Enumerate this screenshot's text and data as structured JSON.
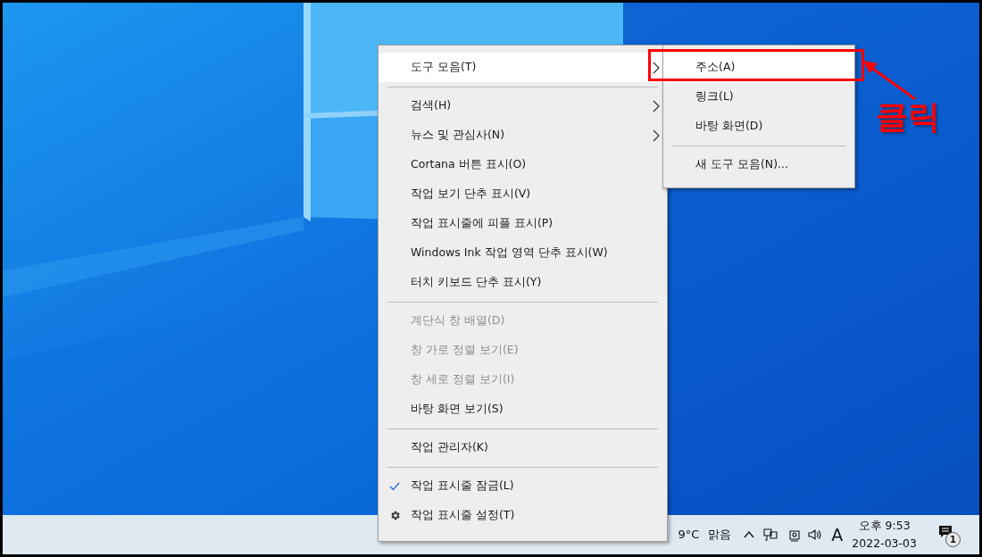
{
  "context_menu": {
    "items": [
      {
        "kind": "item",
        "label": "도구 모음(T)",
        "submenu": true,
        "selected": true,
        "disabled": false
      },
      {
        "kind": "separator"
      },
      {
        "kind": "item",
        "label": "검색(H)",
        "submenu": true,
        "selected": false,
        "disabled": false
      },
      {
        "kind": "item",
        "label": "뉴스 및 관심사(N)",
        "submenu": true,
        "selected": false,
        "disabled": false
      },
      {
        "kind": "item",
        "label": "Cortana 버튼 표시(O)",
        "submenu": false,
        "selected": false,
        "disabled": false
      },
      {
        "kind": "item",
        "label": "작업 보기 단추 표시(V)",
        "submenu": false,
        "selected": false,
        "disabled": false
      },
      {
        "kind": "item",
        "label": "작업 표시줄에 피플 표시(P)",
        "submenu": false,
        "selected": false,
        "disabled": false
      },
      {
        "kind": "item",
        "label": "Windows Ink 작업 영역 단추 표시(W)",
        "submenu": false,
        "selected": false,
        "disabled": false
      },
      {
        "kind": "item",
        "label": "터치 키보드 단추 표시(Y)",
        "submenu": false,
        "selected": false,
        "disabled": false
      },
      {
        "kind": "separator"
      },
      {
        "kind": "item",
        "label": "계단식 창 배열(D)",
        "submenu": false,
        "selected": false,
        "disabled": true
      },
      {
        "kind": "item",
        "label": "창 가로 정렬 보기(E)",
        "submenu": false,
        "selected": false,
        "disabled": true
      },
      {
        "kind": "item",
        "label": "창 세로 정렬 보기(I)",
        "submenu": false,
        "selected": false,
        "disabled": true
      },
      {
        "kind": "item",
        "label": "바탕 화면 보기(S)",
        "submenu": false,
        "selected": false,
        "disabled": false
      },
      {
        "kind": "separator"
      },
      {
        "kind": "item",
        "label": "작업 관리자(K)",
        "submenu": false,
        "selected": false,
        "disabled": false
      },
      {
        "kind": "separator"
      },
      {
        "kind": "check",
        "label": "작업 표시줄 잠금(L)",
        "checked": true,
        "selected": false,
        "disabled": false
      },
      {
        "kind": "settings",
        "label": "작업 표시줄 설정(T)",
        "selected": false,
        "disabled": false
      }
    ]
  },
  "submenu": {
    "items": [
      {
        "kind": "item",
        "label": "주소(A)",
        "selected": true
      },
      {
        "kind": "item",
        "label": "링크(L)",
        "selected": false
      },
      {
        "kind": "item",
        "label": "바탕 화면(D)",
        "selected": false
      },
      {
        "kind": "separator"
      },
      {
        "kind": "item",
        "label": "새 도구 모음(N)...",
        "selected": false
      }
    ]
  },
  "annotation": {
    "label": "클릭"
  },
  "taskbar": {
    "temperature": "9°C",
    "weather": "맑음",
    "input_mode": "A",
    "time": "오후 9:53",
    "date": "2022-03-03",
    "notification_count": "1"
  }
}
